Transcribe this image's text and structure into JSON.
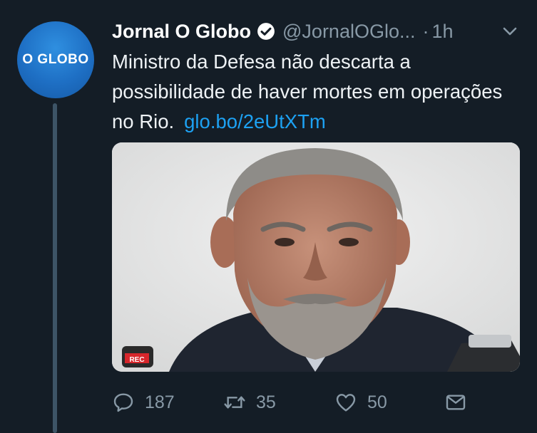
{
  "avatar": {
    "logo_text": "O GLOBO"
  },
  "tweet": {
    "author_name": "Jornal O Globo",
    "handle": "@JornalOGlo...",
    "separator": "·",
    "time": "1h",
    "text": "Ministro da Defesa não descarta a possibilidade de haver mortes em operações no Rio.",
    "link": "glo.bo/2eUtXTm"
  },
  "actions": {
    "reply_count": "187",
    "retweet_count": "35",
    "like_count": "50"
  },
  "media": {
    "mic_label": "REC"
  },
  "icons": {
    "verified": "verified-badge-icon",
    "chevron": "chevron-down-icon",
    "reply": "reply-bubble-icon",
    "retweet": "retweet-arrows-icon",
    "like": "heart-icon",
    "dm": "envelope-icon"
  },
  "colors": {
    "background": "#141d26",
    "link": "#1da1f2",
    "muted": "#8899a6",
    "avatar": "#1e6fc4"
  }
}
